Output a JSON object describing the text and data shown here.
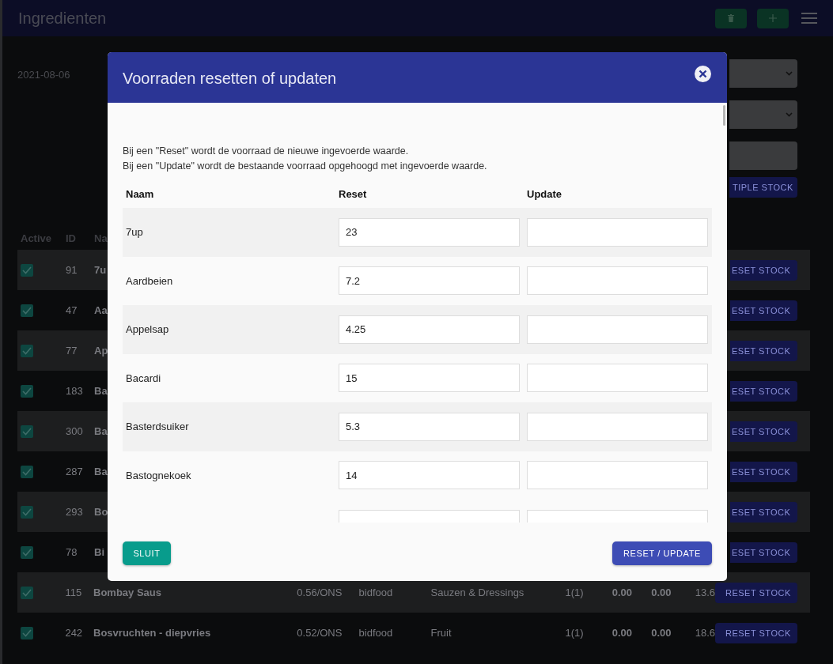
{
  "header": {
    "title": "Ingredienten"
  },
  "filters": {
    "date": "2021-08-06",
    "multiple_stock_button": "TIPLE STOCK"
  },
  "table": {
    "columns": [
      "Active",
      "ID",
      "Na"
    ],
    "rows": [
      {
        "kind": "covered",
        "active": true,
        "id": "91",
        "name": "7u",
        "button": "ESET STOCK"
      },
      {
        "kind": "covered",
        "active": true,
        "id": "47",
        "name": "Aa",
        "button": "ESET STOCK"
      },
      {
        "kind": "covered",
        "active": true,
        "id": "77",
        "name": "Ap",
        "button": "ESET STOCK"
      },
      {
        "kind": "covered",
        "active": true,
        "id": "183",
        "name": "Ba",
        "button": "ESET STOCK"
      },
      {
        "kind": "covered",
        "active": true,
        "id": "300",
        "name": "Ba",
        "button": "ESET STOCK"
      },
      {
        "kind": "covered",
        "active": true,
        "id": "287",
        "name": "Ba",
        "button": "ESET STOCK"
      },
      {
        "kind": "covered",
        "active": true,
        "id": "293",
        "name": "Bo",
        "button": "ESET STOCK"
      },
      {
        "kind": "covered",
        "active": true,
        "id": "78",
        "name": "Bi",
        "button": "ESET STOCK"
      },
      {
        "kind": "full",
        "active": true,
        "id": "115",
        "name": "Bombay Saus",
        "price": "0.56/ONS",
        "supplier": "bidfood",
        "category": "Sauzen & Dressings",
        "units": "1(1)",
        "col_a": "0.00",
        "col_b": "0.00",
        "stock": "13.6",
        "button": "RESET STOCK"
      },
      {
        "kind": "full",
        "active": true,
        "id": "242",
        "name": "Bosvruchten - diepvries",
        "price": "0.52/ONS",
        "supplier": "bidfood",
        "category": "Fruit",
        "units": "1(1)",
        "col_a": "0.00",
        "col_b": "0.00",
        "stock": "18.6",
        "button": "RESET STOCK"
      }
    ]
  },
  "dialog": {
    "title": "Voorraden resetten of updaten",
    "description": [
      "Bij een \"Reset\" wordt de voorraad de nieuwe ingevoerde waarde.",
      "Bij een \"Update\" wordt de bestaande voorraad opgehoogd met ingevoerde waarde."
    ],
    "columns": [
      "Naam",
      "Reset",
      "Update"
    ],
    "rows": [
      {
        "name": "7up",
        "reset": "23"
      },
      {
        "name": "Aardbeien",
        "reset": "7.2"
      },
      {
        "name": "Appelsap",
        "reset": "4.25"
      },
      {
        "name": "Bacardi",
        "reset": "15"
      },
      {
        "name": "Basterdsuiker",
        "reset": "5.3"
      },
      {
        "name": "Bastognekoek",
        "reset": "14"
      }
    ],
    "close_button": "SLUIT",
    "submit_button": "RESET / UPDATE"
  }
}
